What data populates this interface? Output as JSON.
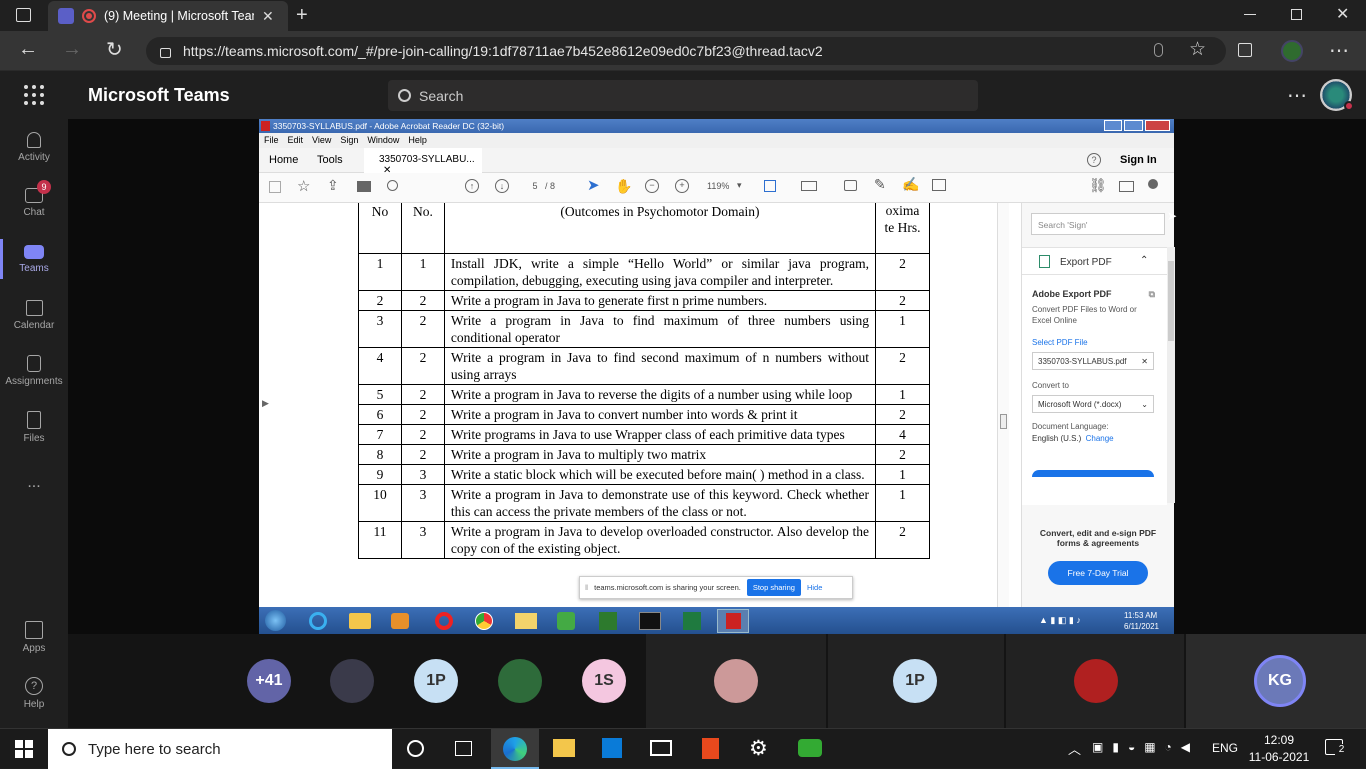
{
  "browser": {
    "tab_title": "(9) Meeting | Microsoft Tean",
    "url": "https://teams.microsoft.com/_#/pre-join-calling/19:1df78711ae7b452e8612e09ed0c7bf23@thread.tacv2"
  },
  "teams": {
    "app_title": "Microsoft Teams",
    "search_placeholder": "Search",
    "rail": [
      {
        "label": "Activity",
        "icon": "bell-icon"
      },
      {
        "label": "Chat",
        "icon": "chat-icon",
        "badge": "9"
      },
      {
        "label": "Teams",
        "icon": "teams-icon"
      },
      {
        "label": "Calendar",
        "icon": "calendar-icon"
      },
      {
        "label": "Assignments",
        "icon": "assignments-icon"
      },
      {
        "label": "Files",
        "icon": "file-icon"
      },
      {
        "label": "...",
        "icon": "more-icon"
      },
      {
        "label": "Apps",
        "icon": "apps-icon"
      },
      {
        "label": "Help",
        "icon": "help-icon"
      }
    ]
  },
  "acrobat": {
    "window_title": "3350703-SYLLABUS.pdf - Adobe Acrobat Reader DC (32-bit)",
    "menu": [
      "File",
      "Edit",
      "View",
      "Sign",
      "Window",
      "Help"
    ],
    "tabs": {
      "home": "Home",
      "tools": "Tools",
      "doc": "3350703-SYLLABU...",
      "sign_in": "Sign In"
    },
    "page_current": "5",
    "page_total": "/ 8",
    "zoom": "119%",
    "side_search_placeholder": "Search 'Sign'",
    "export_pdf": "Export PDF",
    "adobe_export_title": "Adobe Export PDF",
    "adobe_export_desc": "Convert PDF Files to Word or Excel Online",
    "select_pdf_file": "Select PDF File",
    "selected_file": "3350703-SYLLABUS.pdf",
    "convert_to": "Convert to",
    "convert_option": "Microsoft Word (*.docx)",
    "doc_language": "Document Language:",
    "language_value": "English (U.S.)",
    "change": "Change",
    "promo": "Convert, edit and e-sign PDF forms & agreements",
    "trial_button": "Free 7-Day Trial",
    "sharing_text": "teams.microsoft.com is sharing your screen.",
    "stop_sharing": "Stop sharing",
    "hide": "Hide",
    "inner_clock_time": "11:53 AM",
    "inner_clock_date": "6/11/2021"
  },
  "table": {
    "header": [
      "No",
      "No.",
      "(Outcomes in Psychomotor Domain)",
      "oxima te Hrs."
    ],
    "rows": [
      [
        "1",
        "1",
        "Install JDK, write a simple “Hello World” or similar java program, compilation, debugging, executing using java compiler and interpreter.",
        "2"
      ],
      [
        "2",
        "2",
        "Write a program in Java to generate first n prime numbers.",
        "2"
      ],
      [
        "3",
        "2",
        "Write a program in Java to find maximum of three numbers using conditional operator",
        "1"
      ],
      [
        "4",
        "2",
        "Write a program in Java to find second maximum of n numbers without using arrays",
        "2"
      ],
      [
        "5",
        "2",
        "Write a program in Java to reverse the digits of a number using while loop",
        "1"
      ],
      [
        "6",
        "2",
        "Write a program in Java to convert number into words & print it",
        "2"
      ],
      [
        "7",
        "2",
        "Write programs in Java to use Wrapper class of each primitive data types",
        "4"
      ],
      [
        "8",
        "2",
        "Write a program in Java to multiply two matrix",
        "2"
      ],
      [
        "9",
        "3",
        "Write a static block which will be executed before main( ) method in a class.",
        "1"
      ],
      [
        "10",
        "3",
        "Write a program in Java to demonstrate use of this keyword. Check whether this can access the private members of the class or not.",
        "1"
      ],
      [
        "11",
        "3",
        "Write a program in Java to develop overloaded constructor. Also develop the copy con  of the existing object.",
        "2"
      ]
    ]
  },
  "participants": [
    {
      "label": "+41",
      "color": "#6264a7"
    },
    {
      "label": "",
      "color": "#3a3a4a"
    },
    {
      "label": "1P",
      "color": "#c7e0f4"
    },
    {
      "label": "",
      "color": "#2e6b3a"
    },
    {
      "label": "1S",
      "color": "#f4c7e0"
    },
    {
      "label": "",
      "color": "#c99"
    },
    {
      "label": "1P",
      "color": "#c7e0f4"
    },
    {
      "label": "",
      "color": "#b02020"
    },
    {
      "label": "KG",
      "color": "#8a9bd0"
    }
  ],
  "taskbar": {
    "search_placeholder": "Type here to search",
    "lang": "ENG",
    "time": "12:09",
    "date": "11-06-2021",
    "notif_count": "2"
  }
}
